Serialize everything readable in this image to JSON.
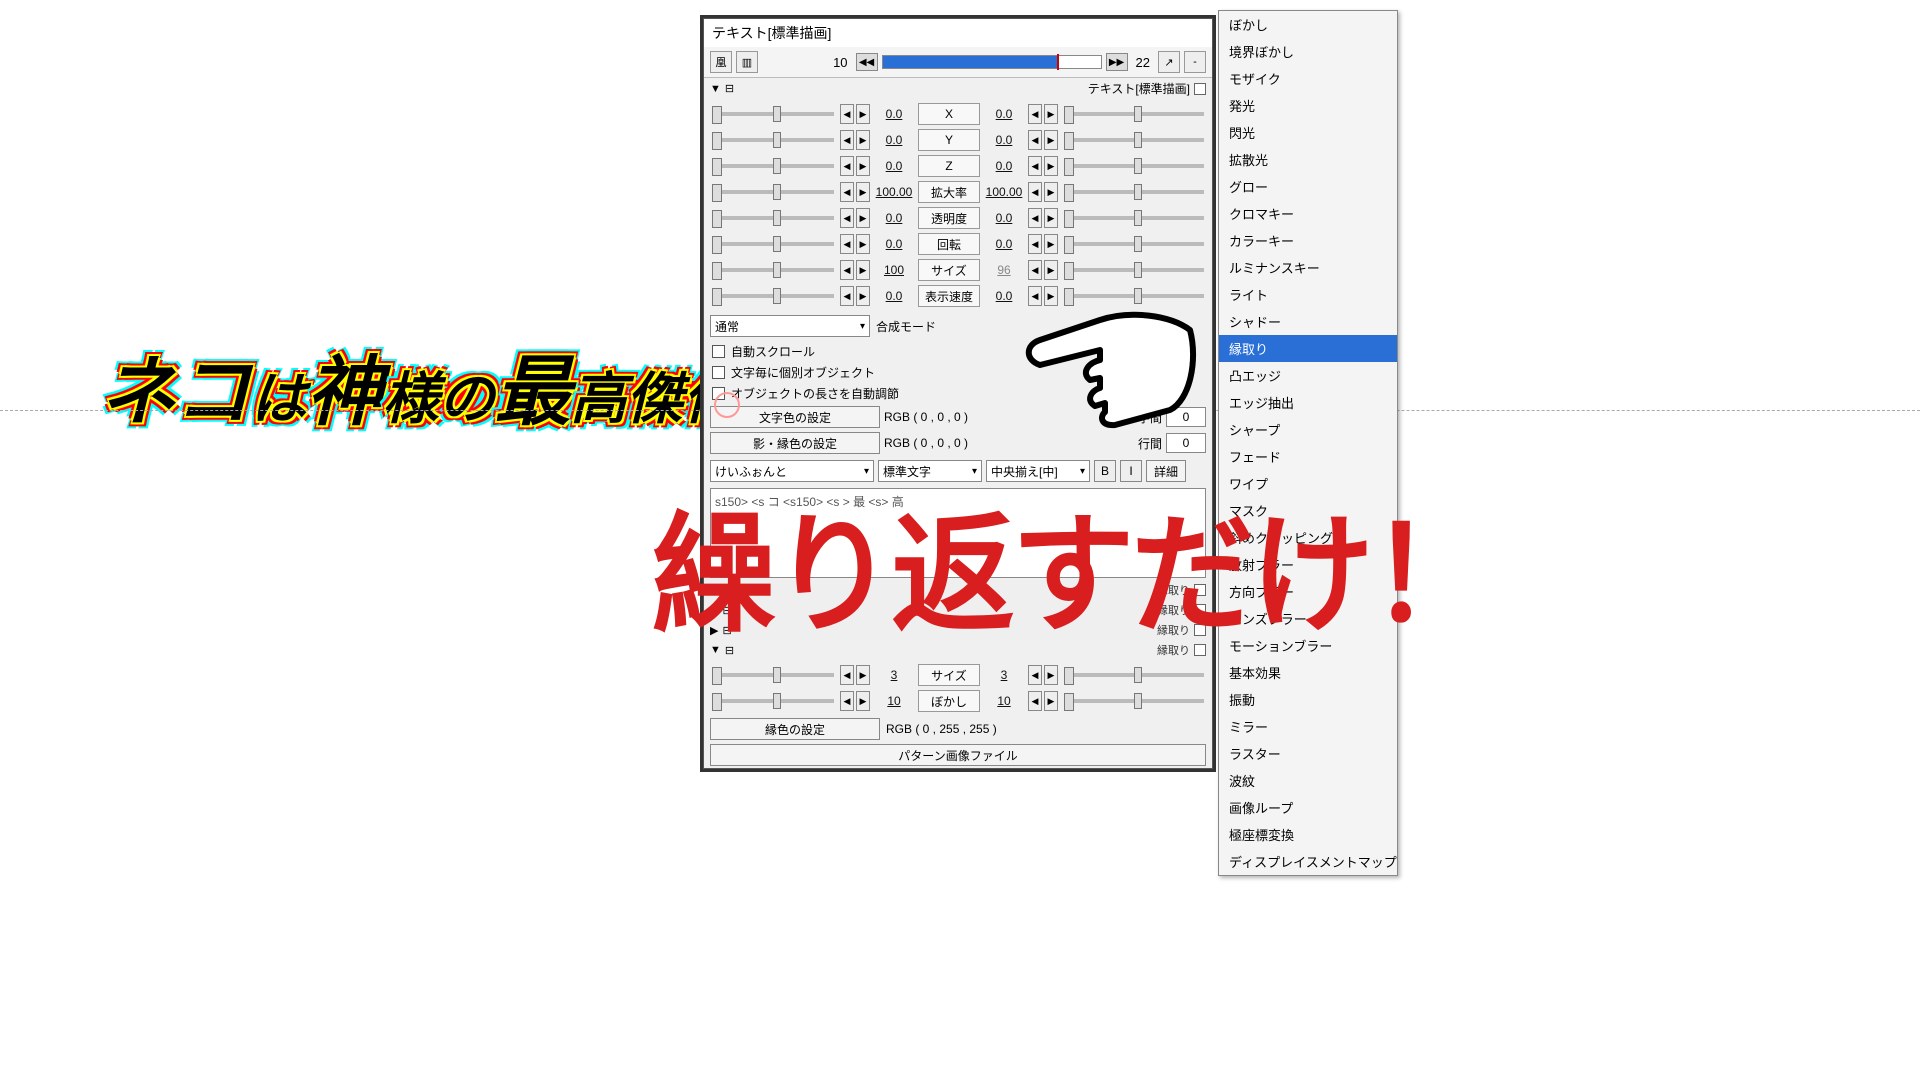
{
  "preview_line": "ネコは神様の最高傑作",
  "overlay_line": "繰り返すだけ！",
  "dialog": {
    "title": "テキスト[標準描画]",
    "frame_start": "10",
    "frame_end": "22",
    "sublabel": "テキスト[標準描画]"
  },
  "params": [
    {
      "l": "0.0",
      "label": "X",
      "r": "0.0"
    },
    {
      "l": "0.0",
      "label": "Y",
      "r": "0.0"
    },
    {
      "l": "0.0",
      "label": "Z",
      "r": "0.0"
    },
    {
      "l": "100.00",
      "label": "拡大率",
      "r": "100.00"
    },
    {
      "l": "0.0",
      "label": "透明度",
      "r": "0.0"
    },
    {
      "l": "0.0",
      "label": "回転",
      "r": "0.0"
    },
    {
      "l": "100",
      "label": "サイズ",
      "r": "96",
      "rdim": true
    },
    {
      "l": "0.0",
      "label": "表示速度",
      "r": "0.0"
    }
  ],
  "blend": {
    "value": "通常",
    "label": "合成モード"
  },
  "checks": {
    "autoscroll": "自動スクロール",
    "perchar": "文字毎に個別オブジェクト",
    "autolen": "オブジェクトの長さを自動調節"
  },
  "color1": {
    "btn": "文字色の設定",
    "rgb": "RGB ( 0 , 0 , 0 )",
    "klabel": "字間",
    "kval": "0"
  },
  "color2": {
    "btn": "影・縁色の設定",
    "rgb": "RGB ( 0 , 0 , 0 )",
    "klabel": "行間",
    "kval": "0"
  },
  "font": {
    "name": "けいふぉんと",
    "style": "標準文字",
    "align": "中央揃え[中]",
    "b": "B",
    "i": "I",
    "detail": "詳細"
  },
  "textarea": "s150> <s コ <s150> <s   > 最 <s> 高",
  "filters": [
    "縁取り",
    "縁取り",
    "縁取り",
    "縁取り"
  ],
  "fparams": [
    {
      "l": "3",
      "label": "サイズ",
      "r": "3"
    },
    {
      "l": "10",
      "label": "ぼかし",
      "r": "10"
    }
  ],
  "edge_color": {
    "btn": "縁色の設定",
    "rgb": "RGB ( 0 , 255 , 255 )"
  },
  "pattern_btn": "パターン画像ファイル",
  "menu": {
    "items": [
      "ぼかし",
      "境界ぼかし",
      "モザイク",
      "発光",
      "閃光",
      "拡散光",
      "グロー",
      "クロマキー",
      "カラーキー",
      "ルミナンスキー",
      "ライト",
      "シャドー",
      "縁取り",
      "凸エッジ",
      "エッジ抽出",
      "シャープ",
      "フェード",
      "ワイプ",
      "マスク",
      "斜めクリッピング",
      "放射ブラー",
      "方向ブラー",
      "レンズブラー",
      "モーションブラー",
      "基本効果",
      "振動",
      "ミラー",
      "ラスター",
      "波紋",
      "画像ループ",
      "極座標変換",
      "ディスプレイスメントマップ"
    ],
    "selected": 12
  }
}
